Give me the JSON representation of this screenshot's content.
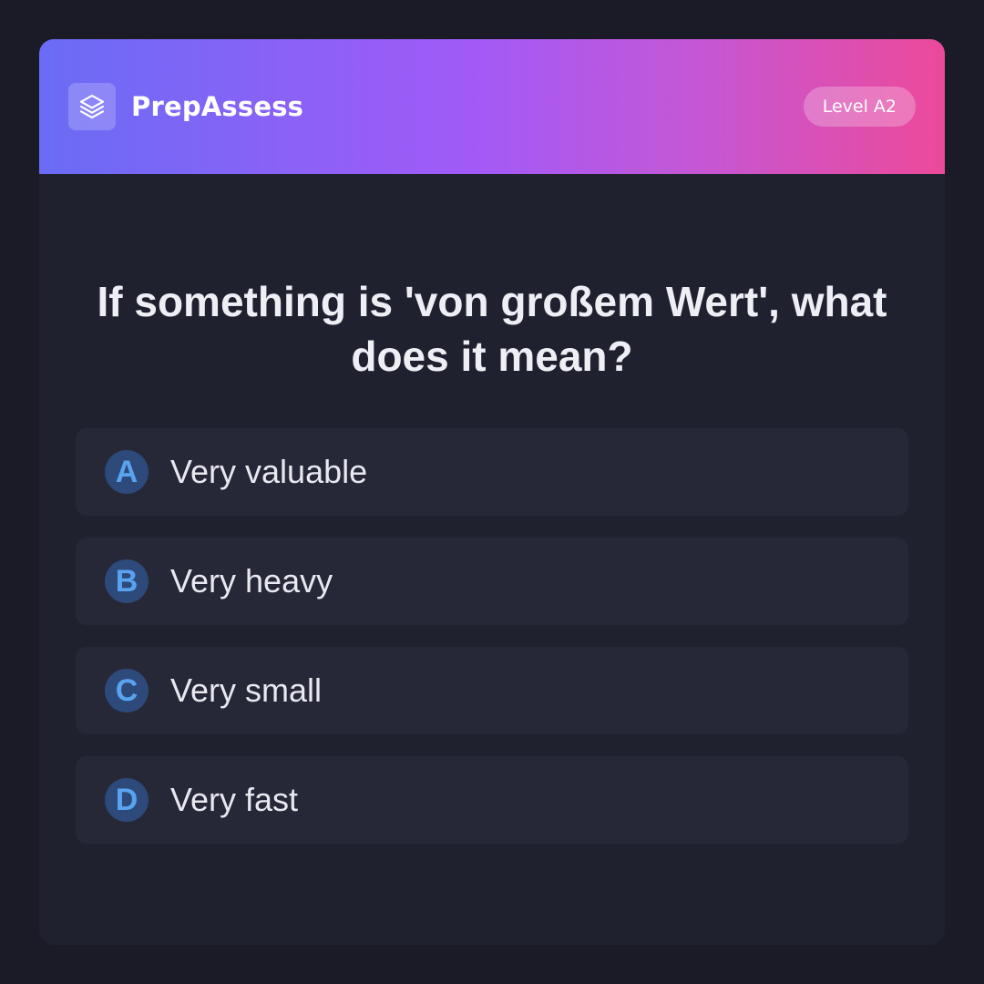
{
  "app": {
    "brand": "PrepAssess",
    "logo_icon": "stacked-layers-icon",
    "level_badge": "Level A2"
  },
  "colors": {
    "gradient": [
      "#6a6cf5",
      "#a25af7",
      "#ec4a9a"
    ],
    "background": "#1a1b26",
    "card": "#20212e",
    "option_bg": "#262837",
    "letter_bg": "#2d4a7a",
    "letter_fg": "#5aa3f0"
  },
  "question": {
    "text": "If something is 'von großem Wert', what does it mean?"
  },
  "options": [
    {
      "letter": "A",
      "text": "Very valuable"
    },
    {
      "letter": "B",
      "text": "Very heavy"
    },
    {
      "letter": "C",
      "text": "Very small"
    },
    {
      "letter": "D",
      "text": "Very fast"
    }
  ]
}
